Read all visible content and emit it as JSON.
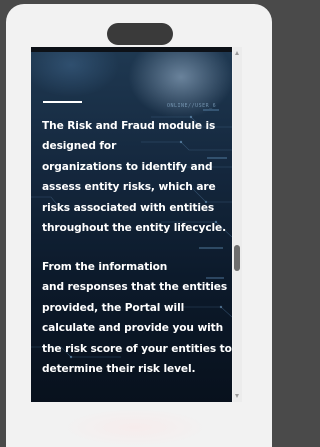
{
  "device": {
    "frame_color": "#f2f2f2",
    "background_color": "#4a4a4a",
    "speaker_color": "#3a3a3a"
  },
  "screen": {
    "hud_text": "ONLINE//USER_6",
    "accent_color": "#ffffff",
    "paragraphs": [
      {
        "lines": [
          "The Risk and Fraud module is",
          "designed for",
          "organizations to identify and",
          "assess entity risks, which are",
          "risks associated with entities",
          "throughout the entity lifecycle."
        ]
      },
      {
        "lines": [
          "From the information",
          "and responses that the entities",
          "provided, the Portal will",
          "calculate and provide you with",
          "the risk score of your entities to",
          "determine their risk level."
        ]
      }
    ]
  },
  "scrollbar": {
    "position_fraction": 0.55,
    "up_icon": "scroll-up-arrow-icon",
    "down_icon": "scroll-down-arrow-icon"
  }
}
